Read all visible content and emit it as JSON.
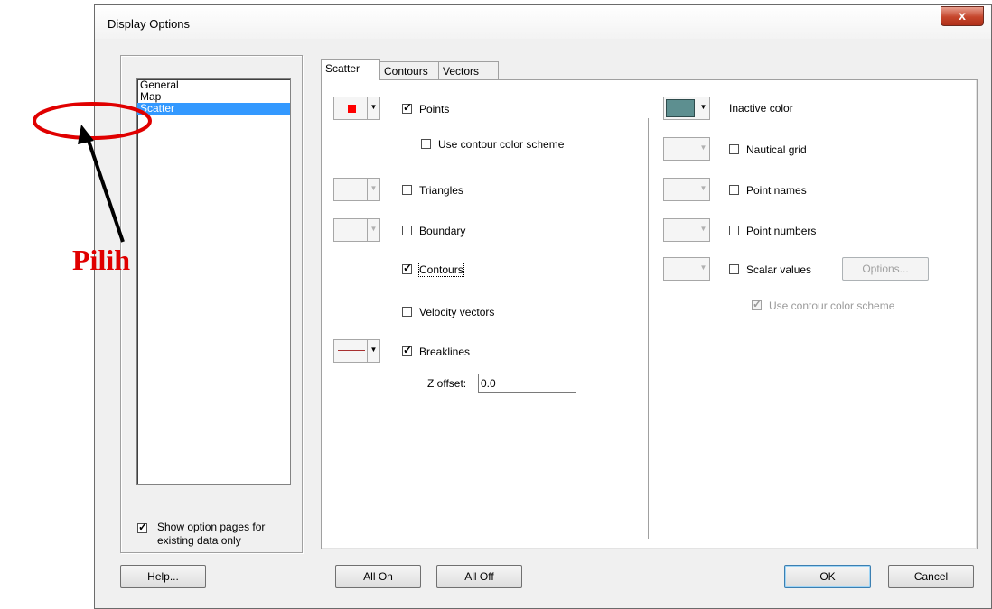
{
  "window": {
    "title": "Display Options",
    "close_label": "x"
  },
  "sidebar": {
    "items": [
      {
        "label": "General",
        "selected": false
      },
      {
        "label": "Map",
        "selected": false
      },
      {
        "label": "Scatter",
        "selected": true
      }
    ],
    "show_option_label_line1": "Show option pages for",
    "show_option_label_line2": "existing data only",
    "show_option_checked": true
  },
  "tabs": [
    {
      "label": "Scatter",
      "active": true
    },
    {
      "label": "Contours",
      "active": false
    },
    {
      "label": "Vectors",
      "active": false
    }
  ],
  "left_options": {
    "points": {
      "label": "Points",
      "checked": true
    },
    "use_contour_color_scheme": {
      "label": "Use contour color scheme",
      "checked": false
    },
    "triangles": {
      "label": "Triangles",
      "checked": false
    },
    "boundary": {
      "label": "Boundary",
      "checked": false
    },
    "contours": {
      "label": "Contours",
      "checked": true
    },
    "velocity_vectors": {
      "label": "Velocity vectors",
      "checked": false
    },
    "breaklines": {
      "label": "Breaklines",
      "checked": true
    },
    "z_offset_label": "Z offset:",
    "z_offset_value": "0.0"
  },
  "right_options": {
    "inactive_color": {
      "label": "Inactive color"
    },
    "nautical_grid": {
      "label": "Nautical grid",
      "checked": false
    },
    "point_names": {
      "label": "Point names",
      "checked": false
    },
    "point_numbers": {
      "label": "Point numbers",
      "checked": false
    },
    "scalar_values": {
      "label": "Scalar values",
      "checked": false
    },
    "options_button": "Options...",
    "use_contour_color_scheme": {
      "label": "Use contour color scheme",
      "checked": true,
      "disabled": true
    }
  },
  "buttons": {
    "help": "Help...",
    "all_on": "All On",
    "all_off": "All Off",
    "ok": "OK",
    "cancel": "Cancel"
  },
  "colors": {
    "points_color": "#ff0000",
    "breaklines_color": "#a83030",
    "inactive_color": "#5d8f90",
    "selection": "#3399ff",
    "annotation": "#e00000"
  },
  "annotation": {
    "text": "Pilih"
  }
}
